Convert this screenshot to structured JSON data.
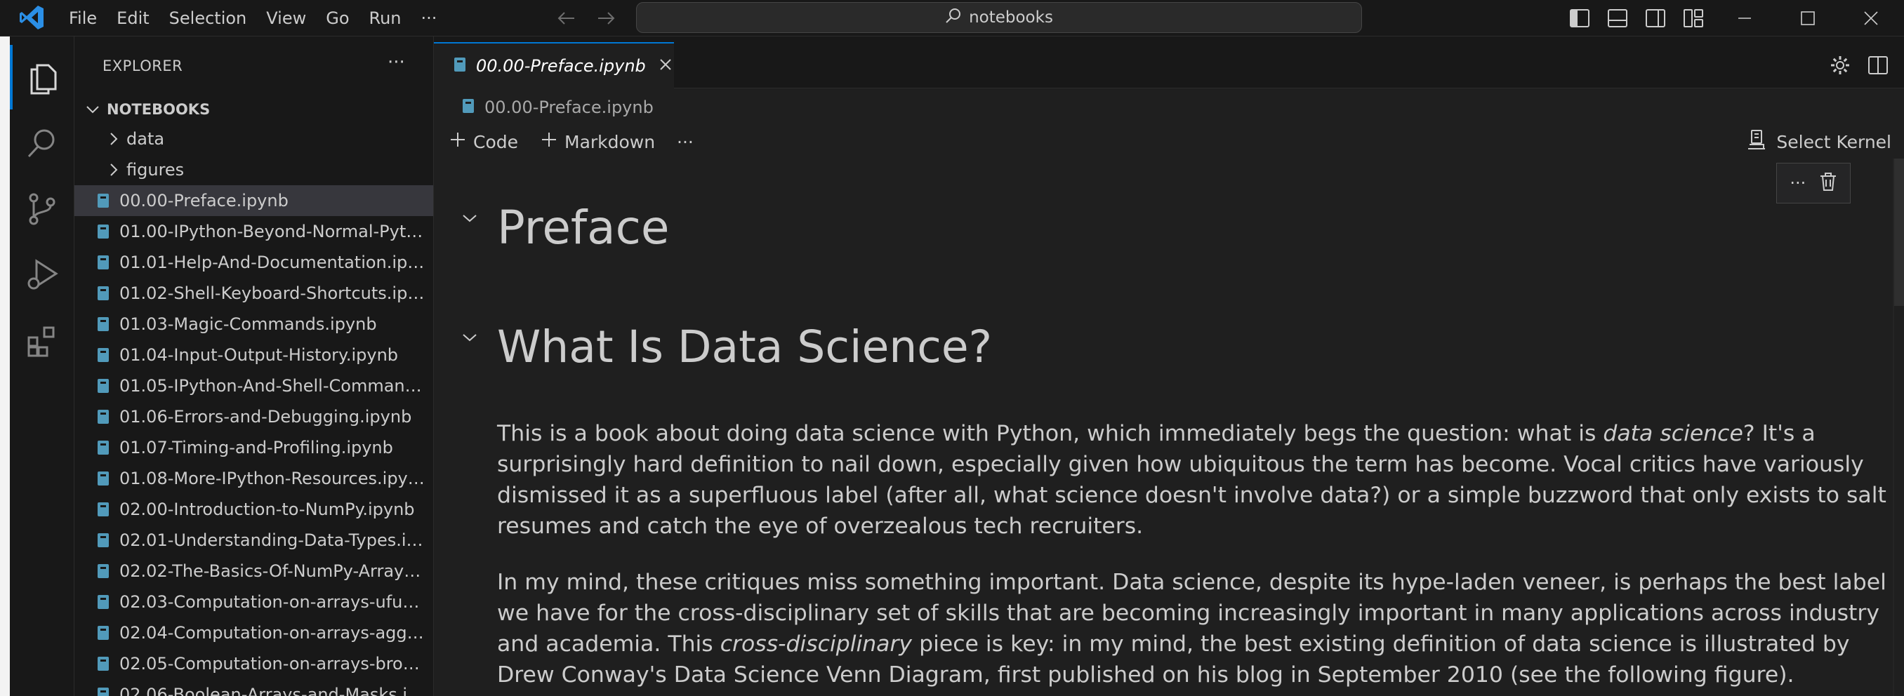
{
  "menu": [
    "File",
    "Edit",
    "Selection",
    "View",
    "Go",
    "Run",
    "···"
  ],
  "search": {
    "text": "notebooks"
  },
  "explorer": {
    "title": "EXPLORER",
    "more": "···",
    "section": "NOTEBOOKS",
    "folders": [
      "data",
      "figures"
    ],
    "files": [
      "00.00-Preface.ipynb",
      "01.00-IPython-Beyond-Normal-Pyth...",
      "01.01-Help-And-Documentation.ipynb",
      "01.02-Shell-Keyboard-Shortcuts.ipynb",
      "01.03-Magic-Commands.ipynb",
      "01.04-Input-Output-History.ipynb",
      "01.05-IPython-And-Shell-Commands...",
      "01.06-Errors-and-Debugging.ipynb",
      "01.07-Timing-and-Profiling.ipynb",
      "01.08-More-IPython-Resources.ipynb",
      "02.00-Introduction-to-NumPy.ipynb",
      "02.01-Understanding-Data-Types.ipy...",
      "02.02-The-Basics-Of-NumPy-Arrays.i...",
      "02.03-Computation-on-arrays-ufunc...",
      "02.04-Computation-on-arrays-aggre...",
      "02.05-Computation-on-arrays-broad...",
      "02.06-Boolean-Arrays-and-Masks.ipy..."
    ]
  },
  "editor": {
    "tab_label": "00.00-Preface.ipynb",
    "breadcrumb": "00.00-Preface.ipynb",
    "toolbar": {
      "code": "Code",
      "markdown": "Markdown",
      "more": "···",
      "kernel": "Select Kernel"
    },
    "cell_more": "···"
  },
  "notebook": {
    "h1": "Preface",
    "h2": "What Is Data Science?",
    "p1": {
      "before": "This is a book about doing data science with Python, which immediately begs the question: what is ",
      "em": "data science",
      "after": "? It's a surprisingly hard definition to nail down, especially given how ubiquitous the term has become. Vocal critics have variously dismissed it as a superfluous label (after all, what science doesn't involve data?) or a simple buzzword that only exists to salt resumes and catch the eye of overzealous tech recruiters."
    },
    "p2": {
      "before": "In my mind, these critiques miss something important. Data science, despite its hype-laden veneer, is perhaps the best label we have for the cross-disciplinary set of skills that are becoming increasingly important in many applications across industry and academia. This ",
      "em": "cross-disciplinary",
      "after": " piece is key: in my mind, the best existing definition of data science is illustrated by Drew Conway's Data Science Venn Diagram, first published on his blog in September 2010 (see the following figure)."
    }
  },
  "colors": {
    "accent": "#0078d4",
    "background": "#1f1f1f",
    "sidebar": "#181818",
    "selection": "#37373d"
  }
}
